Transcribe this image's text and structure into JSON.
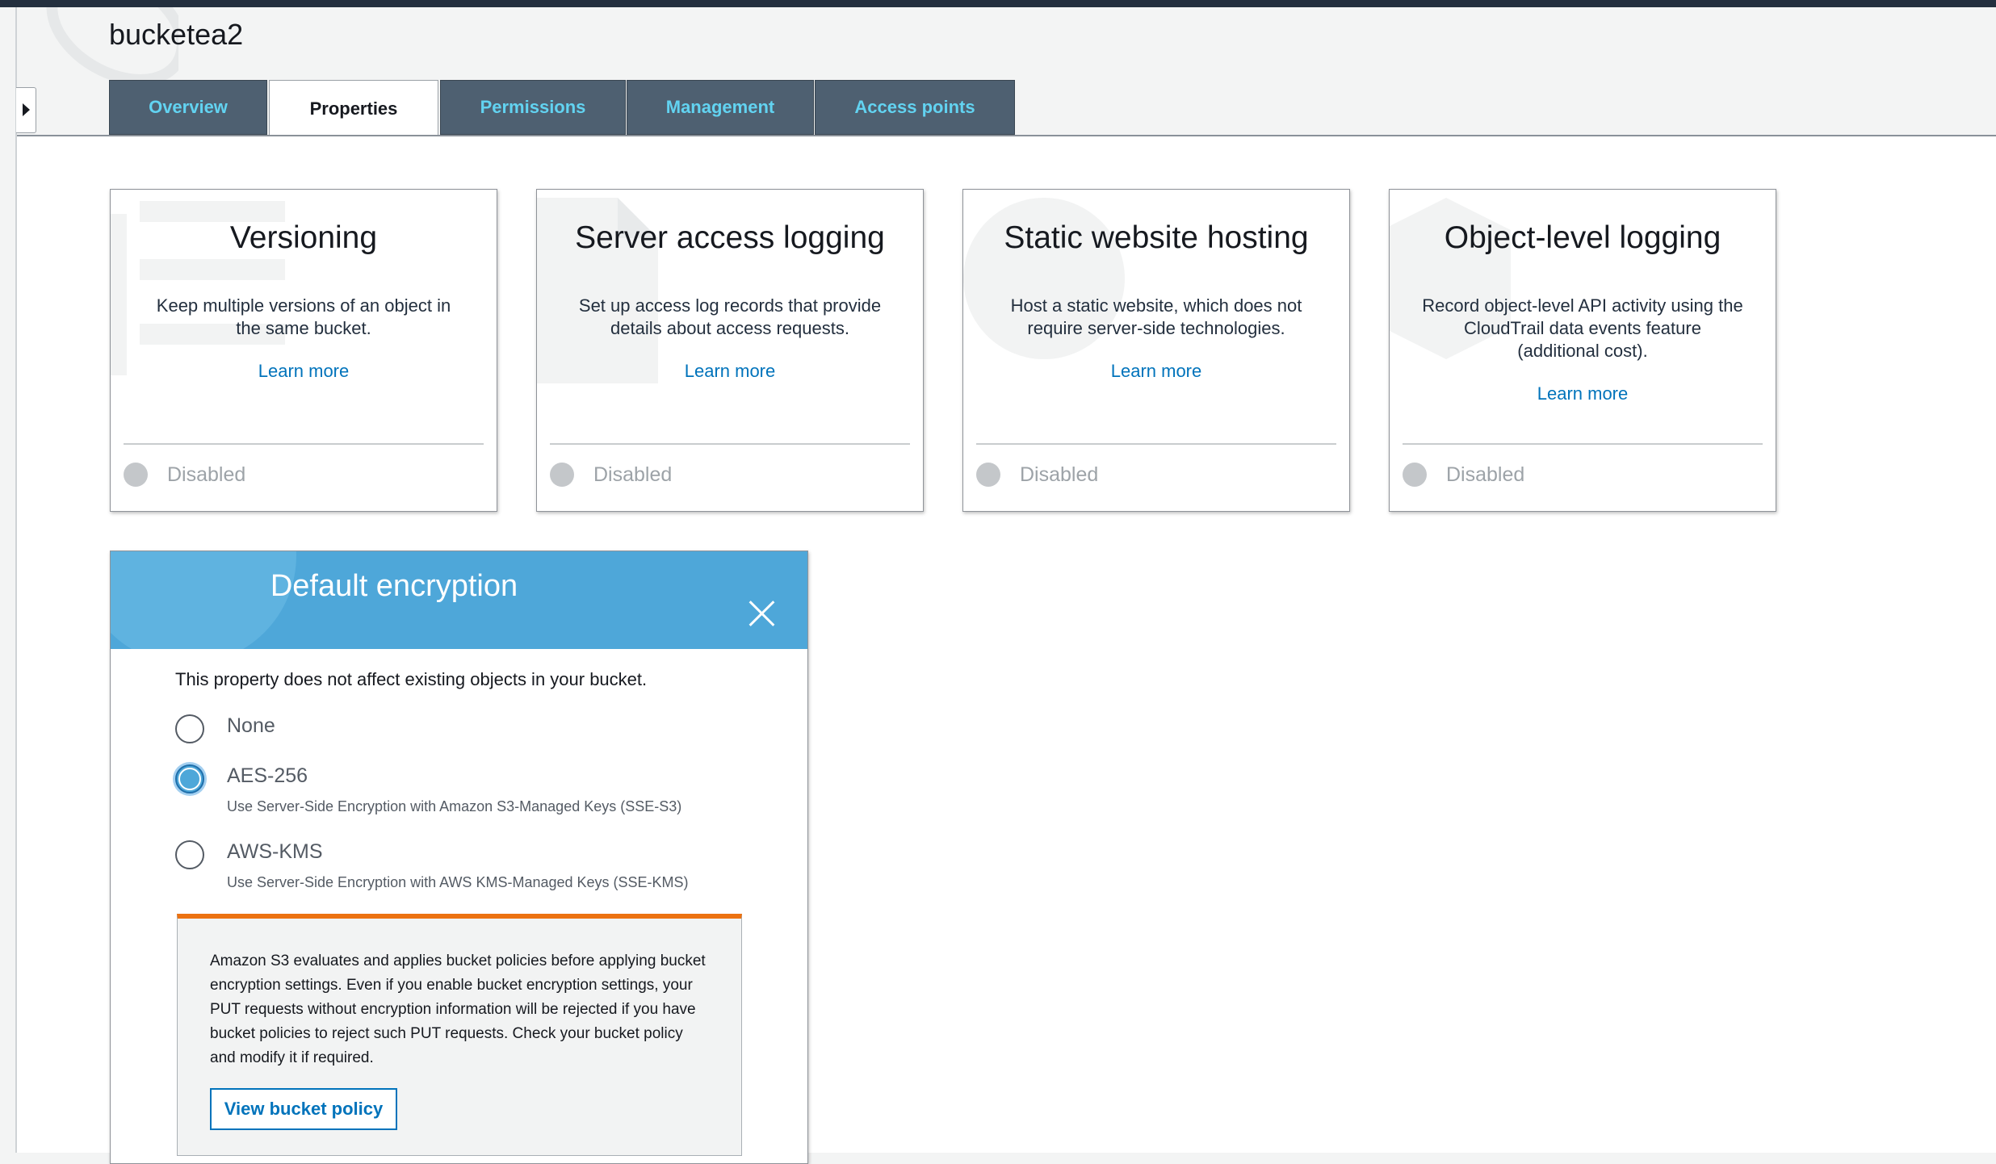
{
  "bucket": {
    "name": "bucketea2"
  },
  "tabs": [
    {
      "label": "Overview"
    },
    {
      "label": "Properties"
    },
    {
      "label": "Permissions"
    },
    {
      "label": "Management"
    },
    {
      "label": "Access points"
    }
  ],
  "active_tab": "Properties",
  "cards": [
    {
      "title": "Versioning",
      "description": "Keep multiple versions of an object in the same bucket.",
      "link": "Learn more",
      "status": "Disabled"
    },
    {
      "title": "Server access logging",
      "description": "Set up access log records that provide details about access requests.",
      "link": "Learn more",
      "status": "Disabled"
    },
    {
      "title": "Static website hosting",
      "description": "Host a static website, which does not require server-side technologies.",
      "link": "Learn more",
      "status": "Disabled"
    },
    {
      "title": "Object-level logging",
      "description": "Record object-level API activity using the CloudTrail data events feature (additional cost).",
      "link": "Learn more",
      "status": "Disabled"
    }
  ],
  "encryption": {
    "title": "Default encryption",
    "note": "This property does not affect existing objects in your bucket.",
    "options": [
      {
        "label": "None",
        "sub": ""
      },
      {
        "label": "AES-256",
        "sub": "Use Server-Side Encryption with Amazon S3-Managed Keys (SSE-S3)"
      },
      {
        "label": "AWS-KMS",
        "sub": "Use Server-Side Encryption with AWS KMS-Managed Keys (SSE-KMS)"
      }
    ],
    "selected": "AES-256",
    "warning": "Amazon S3 evaluates and applies bucket policies before applying bucket encryption settings. Even if you enable bucket encryption settings, your PUT requests without encryption information will be rejected if you have bucket policies to reject such PUT requests. Check your bucket policy and modify it if required.",
    "button": "View bucket policy"
  },
  "colors": {
    "tab_bg": "#4e6071",
    "tab_text": "#62d3f1",
    "header_blue": "#4ea7d9",
    "link": "#0073bb",
    "warning_accent": "#ec7211"
  }
}
